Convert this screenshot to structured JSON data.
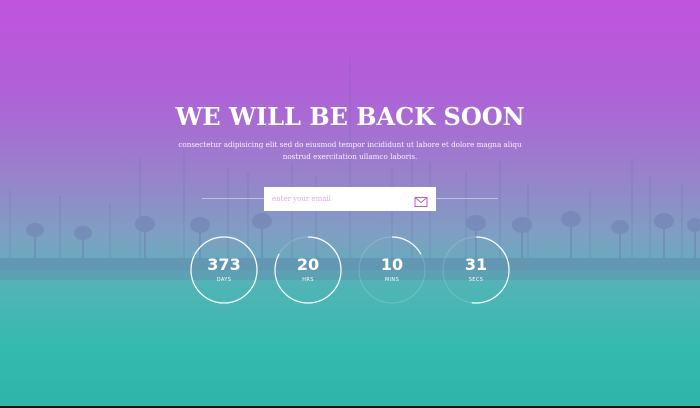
{
  "hero": {
    "title": "WE WILL BE BACK SOON",
    "subtitle_line1": "consectetur adipisicing elit sed do eiusmod tempor incididunt ut labore et dolore magna aliqu",
    "subtitle_line2": "nostrud exercitation ullamco laboris."
  },
  "subscribe": {
    "placeholder": "enter your email"
  },
  "countdown": [
    {
      "value": "373",
      "label": "DAYS",
      "progress": 1.0
    },
    {
      "value": "20",
      "label": "HRS",
      "progress": 0.83
    },
    {
      "value": "10",
      "label": "MINS",
      "progress": 0.17
    },
    {
      "value": "31",
      "label": "SECS",
      "progress": 0.52
    }
  ],
  "colors": {
    "gradient_top": "#c054dc",
    "gradient_bottom": "#2eb4a8",
    "text": "#ffffff"
  }
}
